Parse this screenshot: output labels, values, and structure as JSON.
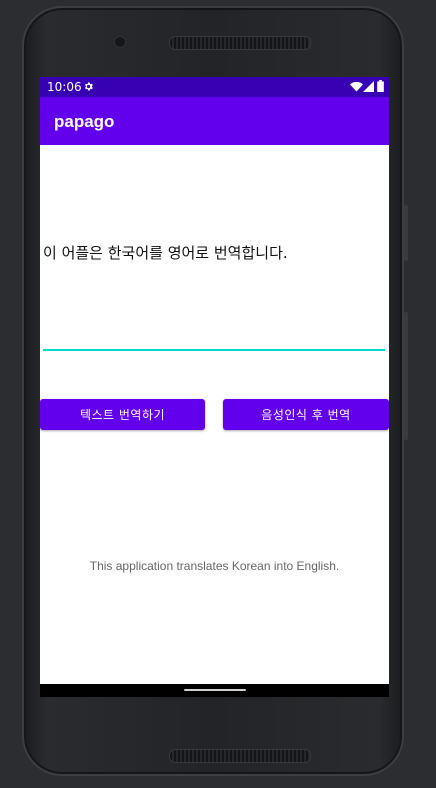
{
  "status_bar": {
    "time": "10:06",
    "icons": [
      "gear-icon",
      "wifi-icon",
      "signal-icon",
      "battery-icon"
    ],
    "color": "#3700b3"
  },
  "app_bar": {
    "title": "papago",
    "color": "#6200ee"
  },
  "main": {
    "prompt": "이 어플은 한국어를 영어로 번역합니다.",
    "input": {
      "value": "",
      "placeholder": "",
      "underline_color": "#03dac5"
    },
    "buttons": {
      "text_translate": "텍스트 번역하기",
      "voice_translate": "음성인식 후 번역"
    },
    "description": "This application translates Korean into English."
  },
  "colors": {
    "primary": "#6200ee",
    "primary_dark": "#3700b3",
    "accent": "#03dac5"
  }
}
